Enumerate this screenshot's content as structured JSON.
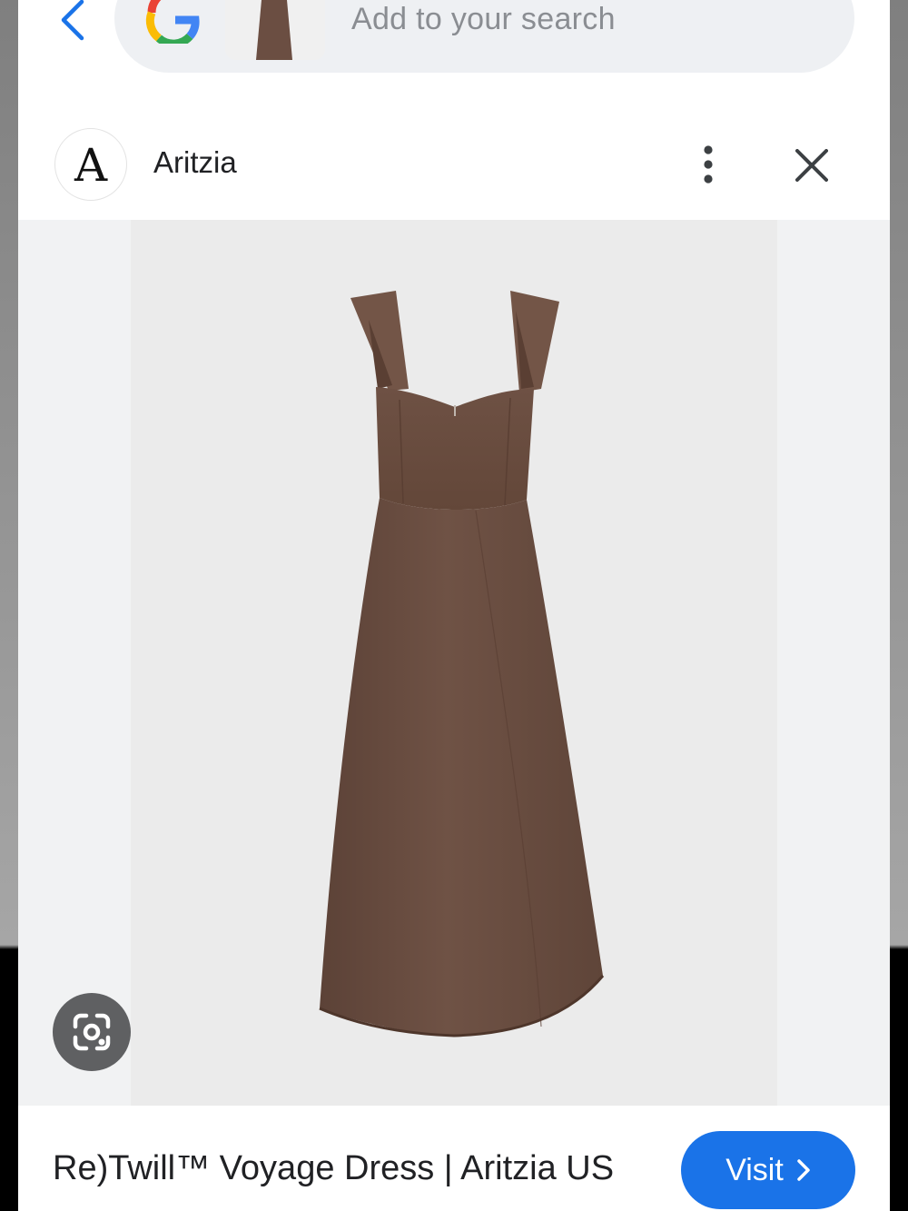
{
  "search": {
    "placeholder": "Add to your search",
    "engine_icon": "google-g-icon",
    "thumbnail": "dress-thumbnail"
  },
  "header": {
    "brand_logo_letter": "A",
    "brand_name": "Aritzia",
    "menu_icon": "more-vert-icon",
    "close_icon": "close-icon"
  },
  "image": {
    "subject": "dress-photo",
    "lens_icon": "google-lens-icon"
  },
  "result": {
    "title": "Re)Twill™ Voyage Dress | Aritzia US",
    "visit_label": "Visit",
    "visit_icon": "chevron-right-icon"
  },
  "colors": {
    "accent": "#1a73e8",
    "dress": "#6b4e42",
    "photo_bg": "#ebebeb"
  }
}
